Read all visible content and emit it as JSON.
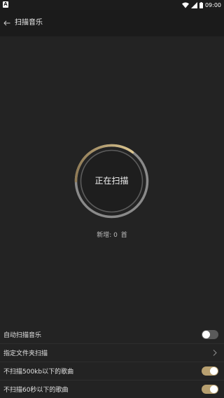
{
  "status_bar": {
    "time": "09:00"
  },
  "header": {
    "title": "扫描音乐"
  },
  "scanner": {
    "status_label": "正在扫描",
    "progress_fraction": 0.35
  },
  "summary": {
    "new_label": "新增: 0",
    "unit": "首"
  },
  "settings": {
    "items": [
      {
        "label": "自动扫描音乐",
        "control": "toggle",
        "on": false
      },
      {
        "label": "指定文件夹扫描",
        "control": "chevron"
      },
      {
        "label": "不扫描500kb以下的歌曲",
        "control": "toggle",
        "on": true
      },
      {
        "label": "不扫描60秒以下的歌曲",
        "control": "toggle",
        "on": true
      }
    ]
  },
  "colors": {
    "accent": "#b8a070",
    "ring_track": "#8a8a8a",
    "background": "#232323"
  }
}
